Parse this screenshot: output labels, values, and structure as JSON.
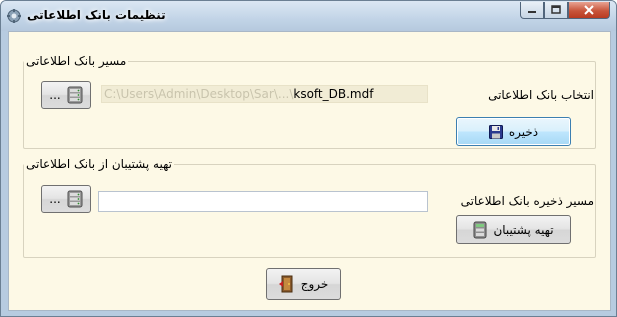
{
  "window": {
    "title": "تنظیمات بانک اطلاعاتی",
    "icon": "app-gear-icon"
  },
  "caption_buttons": {
    "minimize": "minimize-icon",
    "maximize": "maximize-icon",
    "close": "close-icon"
  },
  "db_path_group": {
    "legend": "مسیر بانک اطلاعاتی",
    "select_label": "انتخاب بانک اطلاعاتی",
    "path_visible": "ksoft_DB.mdf",
    "path_faded": "C:\\Users\\Admin\\Desktop\\Sar\\...\\",
    "browse_label": "...",
    "browse_icon": "database-icon",
    "save_label": "ذخیره",
    "save_icon": "floppy-disk-icon"
  },
  "backup_group": {
    "legend": "تهیه پشتیبان از بانک اطلاعاتی",
    "path_label": "مسیر ذخیره بانک اطلاعاتی",
    "path_value": "",
    "browse_label": "...",
    "browse_icon": "database-icon",
    "backup_label": "تهیه پشتیبان",
    "backup_icon": "database-backup-icon"
  },
  "footer": {
    "exit_label": "خروج",
    "exit_icon": "exit-door-icon"
  }
}
